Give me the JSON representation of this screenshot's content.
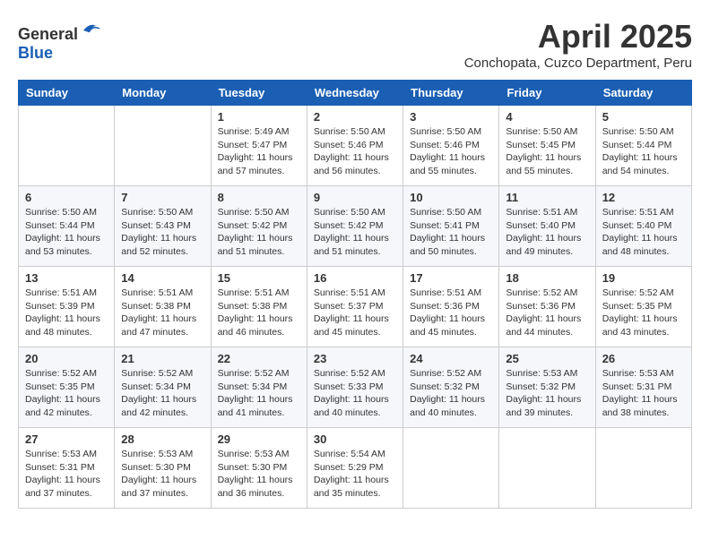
{
  "logo": {
    "text_general": "General",
    "text_blue": "Blue"
  },
  "title": "April 2025",
  "location": "Conchopata, Cuzco Department, Peru",
  "weekdays": [
    "Sunday",
    "Monday",
    "Tuesday",
    "Wednesday",
    "Thursday",
    "Friday",
    "Saturday"
  ],
  "weeks": [
    [
      {
        "day": "",
        "sunrise": "",
        "sunset": "",
        "daylight": ""
      },
      {
        "day": "",
        "sunrise": "",
        "sunset": "",
        "daylight": ""
      },
      {
        "day": "1",
        "sunrise": "Sunrise: 5:49 AM",
        "sunset": "Sunset: 5:47 PM",
        "daylight": "Daylight: 11 hours and 57 minutes."
      },
      {
        "day": "2",
        "sunrise": "Sunrise: 5:50 AM",
        "sunset": "Sunset: 5:46 PM",
        "daylight": "Daylight: 11 hours and 56 minutes."
      },
      {
        "day": "3",
        "sunrise": "Sunrise: 5:50 AM",
        "sunset": "Sunset: 5:46 PM",
        "daylight": "Daylight: 11 hours and 55 minutes."
      },
      {
        "day": "4",
        "sunrise": "Sunrise: 5:50 AM",
        "sunset": "Sunset: 5:45 PM",
        "daylight": "Daylight: 11 hours and 55 minutes."
      },
      {
        "day": "5",
        "sunrise": "Sunrise: 5:50 AM",
        "sunset": "Sunset: 5:44 PM",
        "daylight": "Daylight: 11 hours and 54 minutes."
      }
    ],
    [
      {
        "day": "6",
        "sunrise": "Sunrise: 5:50 AM",
        "sunset": "Sunset: 5:44 PM",
        "daylight": "Daylight: 11 hours and 53 minutes."
      },
      {
        "day": "7",
        "sunrise": "Sunrise: 5:50 AM",
        "sunset": "Sunset: 5:43 PM",
        "daylight": "Daylight: 11 hours and 52 minutes."
      },
      {
        "day": "8",
        "sunrise": "Sunrise: 5:50 AM",
        "sunset": "Sunset: 5:42 PM",
        "daylight": "Daylight: 11 hours and 51 minutes."
      },
      {
        "day": "9",
        "sunrise": "Sunrise: 5:50 AM",
        "sunset": "Sunset: 5:42 PM",
        "daylight": "Daylight: 11 hours and 51 minutes."
      },
      {
        "day": "10",
        "sunrise": "Sunrise: 5:50 AM",
        "sunset": "Sunset: 5:41 PM",
        "daylight": "Daylight: 11 hours and 50 minutes."
      },
      {
        "day": "11",
        "sunrise": "Sunrise: 5:51 AM",
        "sunset": "Sunset: 5:40 PM",
        "daylight": "Daylight: 11 hours and 49 minutes."
      },
      {
        "day": "12",
        "sunrise": "Sunrise: 5:51 AM",
        "sunset": "Sunset: 5:40 PM",
        "daylight": "Daylight: 11 hours and 48 minutes."
      }
    ],
    [
      {
        "day": "13",
        "sunrise": "Sunrise: 5:51 AM",
        "sunset": "Sunset: 5:39 PM",
        "daylight": "Daylight: 11 hours and 48 minutes."
      },
      {
        "day": "14",
        "sunrise": "Sunrise: 5:51 AM",
        "sunset": "Sunset: 5:38 PM",
        "daylight": "Daylight: 11 hours and 47 minutes."
      },
      {
        "day": "15",
        "sunrise": "Sunrise: 5:51 AM",
        "sunset": "Sunset: 5:38 PM",
        "daylight": "Daylight: 11 hours and 46 minutes."
      },
      {
        "day": "16",
        "sunrise": "Sunrise: 5:51 AM",
        "sunset": "Sunset: 5:37 PM",
        "daylight": "Daylight: 11 hours and 45 minutes."
      },
      {
        "day": "17",
        "sunrise": "Sunrise: 5:51 AM",
        "sunset": "Sunset: 5:36 PM",
        "daylight": "Daylight: 11 hours and 45 minutes."
      },
      {
        "day": "18",
        "sunrise": "Sunrise: 5:52 AM",
        "sunset": "Sunset: 5:36 PM",
        "daylight": "Daylight: 11 hours and 44 minutes."
      },
      {
        "day": "19",
        "sunrise": "Sunrise: 5:52 AM",
        "sunset": "Sunset: 5:35 PM",
        "daylight": "Daylight: 11 hours and 43 minutes."
      }
    ],
    [
      {
        "day": "20",
        "sunrise": "Sunrise: 5:52 AM",
        "sunset": "Sunset: 5:35 PM",
        "daylight": "Daylight: 11 hours and 42 minutes."
      },
      {
        "day": "21",
        "sunrise": "Sunrise: 5:52 AM",
        "sunset": "Sunset: 5:34 PM",
        "daylight": "Daylight: 11 hours and 42 minutes."
      },
      {
        "day": "22",
        "sunrise": "Sunrise: 5:52 AM",
        "sunset": "Sunset: 5:34 PM",
        "daylight": "Daylight: 11 hours and 41 minutes."
      },
      {
        "day": "23",
        "sunrise": "Sunrise: 5:52 AM",
        "sunset": "Sunset: 5:33 PM",
        "daylight": "Daylight: 11 hours and 40 minutes."
      },
      {
        "day": "24",
        "sunrise": "Sunrise: 5:52 AM",
        "sunset": "Sunset: 5:32 PM",
        "daylight": "Daylight: 11 hours and 40 minutes."
      },
      {
        "day": "25",
        "sunrise": "Sunrise: 5:53 AM",
        "sunset": "Sunset: 5:32 PM",
        "daylight": "Daylight: 11 hours and 39 minutes."
      },
      {
        "day": "26",
        "sunrise": "Sunrise: 5:53 AM",
        "sunset": "Sunset: 5:31 PM",
        "daylight": "Daylight: 11 hours and 38 minutes."
      }
    ],
    [
      {
        "day": "27",
        "sunrise": "Sunrise: 5:53 AM",
        "sunset": "Sunset: 5:31 PM",
        "daylight": "Daylight: 11 hours and 37 minutes."
      },
      {
        "day": "28",
        "sunrise": "Sunrise: 5:53 AM",
        "sunset": "Sunset: 5:30 PM",
        "daylight": "Daylight: 11 hours and 37 minutes."
      },
      {
        "day": "29",
        "sunrise": "Sunrise: 5:53 AM",
        "sunset": "Sunset: 5:30 PM",
        "daylight": "Daylight: 11 hours and 36 minutes."
      },
      {
        "day": "30",
        "sunrise": "Sunrise: 5:54 AM",
        "sunset": "Sunset: 5:29 PM",
        "daylight": "Daylight: 11 hours and 35 minutes."
      },
      {
        "day": "",
        "sunrise": "",
        "sunset": "",
        "daylight": ""
      },
      {
        "day": "",
        "sunrise": "",
        "sunset": "",
        "daylight": ""
      },
      {
        "day": "",
        "sunrise": "",
        "sunset": "",
        "daylight": ""
      }
    ]
  ]
}
